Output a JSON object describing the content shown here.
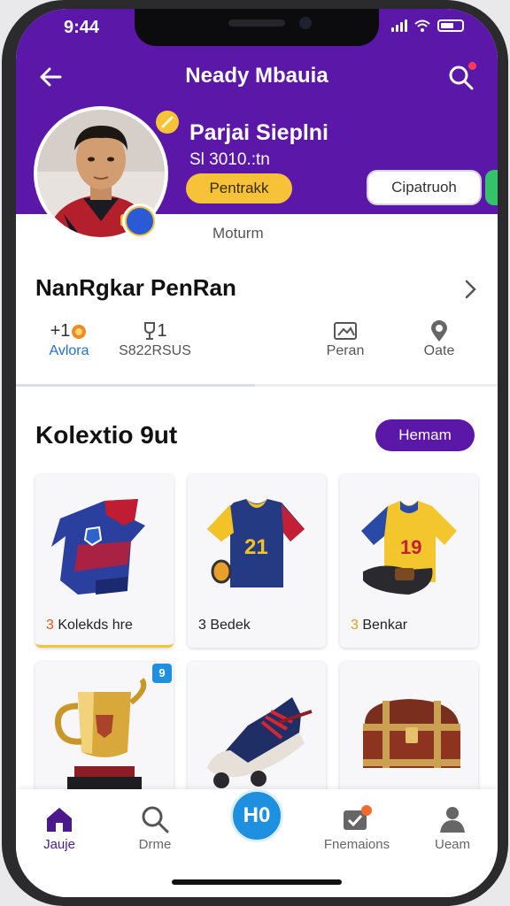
{
  "status_bar": {
    "time": "9:44"
  },
  "header": {
    "title": "Neady Mbauia",
    "player_name": "Parjai Sieplni",
    "player_sub": "Sl 3010.:tn",
    "yellow_button": "Pentrakk",
    "white_button": "Cipatruoh",
    "motion_label": "Moturm"
  },
  "rank_section": {
    "title": "NanRgkar PenRan",
    "stats": [
      {
        "value": "+1",
        "label": "Avlora",
        "icon": "badge-icon"
      },
      {
        "value": "1",
        "label": "S822RSUS",
        "icon": "trophy-icon"
      },
      {
        "value": "",
        "label": "Peran",
        "icon": "image-icon"
      },
      {
        "value": "",
        "label": "Oate",
        "icon": "pin-icon"
      }
    ]
  },
  "collection": {
    "title": "Kolextio 9ut",
    "button": "Hemam",
    "items": [
      {
        "caption": "Kolekds hre",
        "count": "3",
        "art": "kit-red-blue"
      },
      {
        "caption": "Bedek",
        "count": "3",
        "art": "jersey-21"
      },
      {
        "caption": "Benkar",
        "count": "3",
        "art": "jersey-yellow-19"
      },
      {
        "art": "gold-trophy"
      },
      {
        "art": "sneaker"
      },
      {
        "art": "treasure-chest"
      }
    ],
    "jersey_number": "21",
    "jersey_number_2": "19",
    "badge": "9"
  },
  "tabbar": {
    "tabs": [
      {
        "label": "Jauje",
        "icon": "home-icon"
      },
      {
        "label": "Drme",
        "icon": "search-icon"
      },
      {
        "label": "Fnemaions",
        "icon": "message-icon"
      },
      {
        "label": "Ueam",
        "icon": "user-icon"
      }
    ],
    "fab_label": "H0"
  },
  "colors": {
    "primary": "#5b17a8",
    "accent": "#f6c338",
    "blue": "#1f8fe0"
  }
}
